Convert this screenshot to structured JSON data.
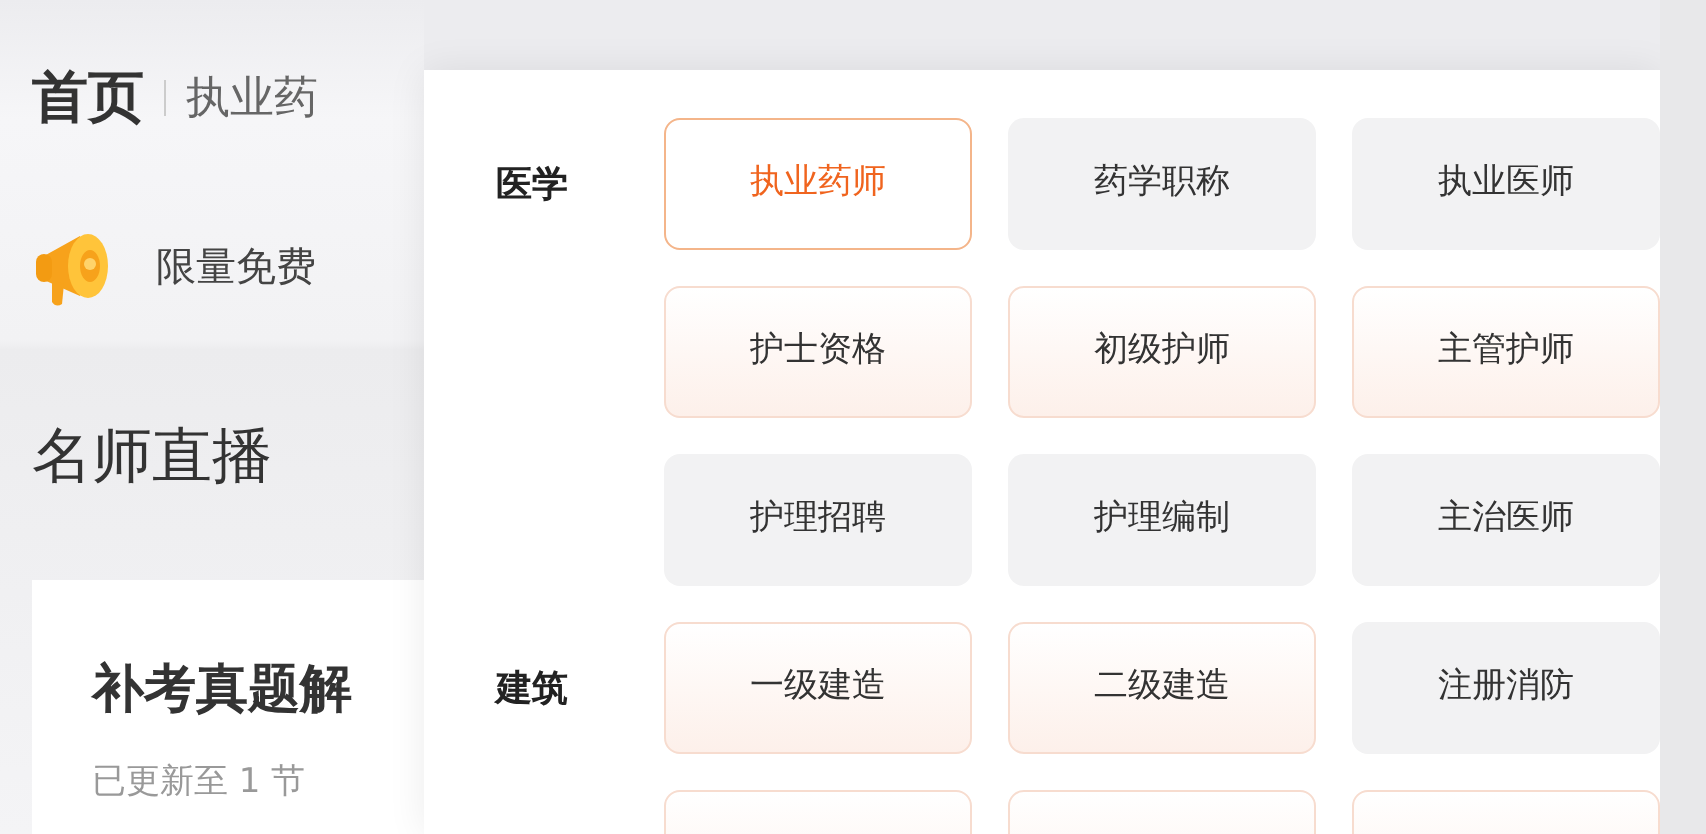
{
  "page": {
    "title": "首页",
    "exam": "执业药",
    "notice": "限量免费",
    "section_title": "名师直播",
    "course": {
      "title": "补考真题解",
      "subtitle": "已更新至 1 节"
    }
  },
  "panel": {
    "groups": [
      {
        "label": "医学",
        "items": [
          {
            "label": "执业药师",
            "kind": "plain",
            "selected": true
          },
          {
            "label": "药学职称",
            "kind": "plain",
            "selected": false
          },
          {
            "label": "执业医师",
            "kind": "plain",
            "selected": false
          },
          {
            "label": "护士资格",
            "kind": "peach",
            "selected": false
          },
          {
            "label": "初级护师",
            "kind": "peach",
            "selected": false
          },
          {
            "label": "主管护师",
            "kind": "peach",
            "selected": false
          },
          {
            "label": "护理招聘",
            "kind": "plain",
            "selected": false
          },
          {
            "label": "护理编制",
            "kind": "plain",
            "selected": false
          },
          {
            "label": "主治医师",
            "kind": "plain",
            "selected": false
          }
        ]
      },
      {
        "label": "建筑",
        "items": [
          {
            "label": "一级建造",
            "kind": "peach",
            "selected": false
          },
          {
            "label": "二级建造",
            "kind": "peach",
            "selected": false
          },
          {
            "label": "注册消防",
            "kind": "plain",
            "selected": false
          },
          {
            "kind": "peach",
            "selected": false
          },
          {
            "kind": "peach",
            "selected": false
          },
          {
            "kind": "peach",
            "selected": false
          }
        ]
      }
    ]
  }
}
